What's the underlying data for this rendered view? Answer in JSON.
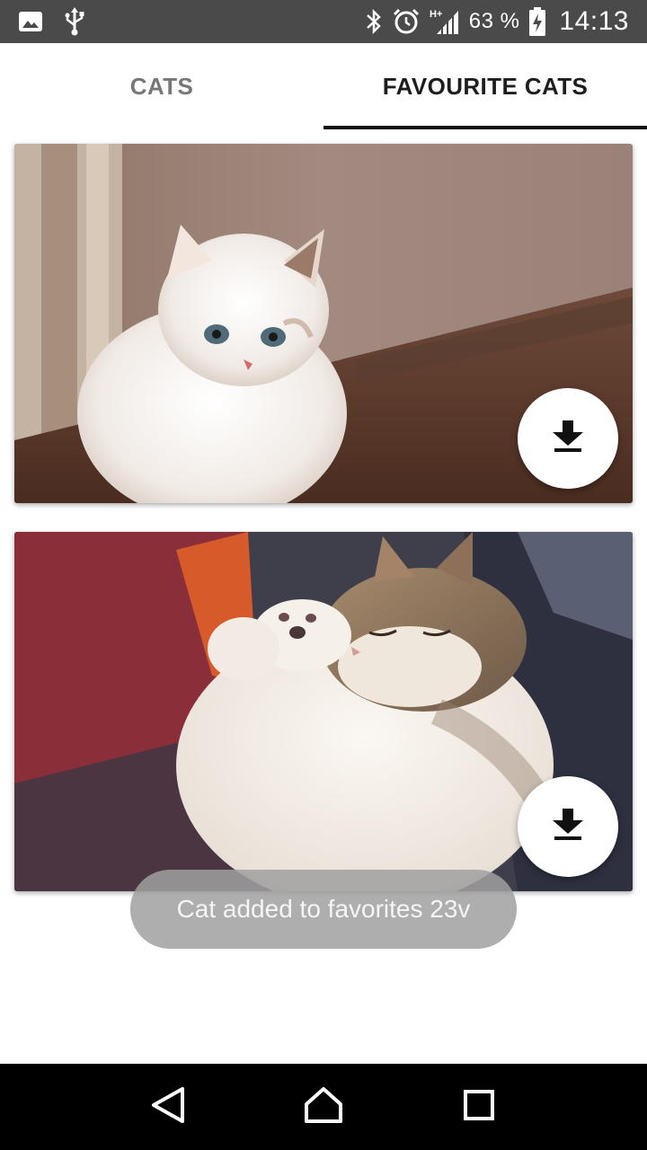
{
  "status_bar": {
    "battery_percent": "63 %",
    "time": "14:13",
    "network_label": "H+",
    "icons": [
      "image-icon",
      "usb-icon",
      "bluetooth-icon",
      "alarm-icon",
      "signal-icon",
      "battery-charging-icon"
    ]
  },
  "tabs": [
    {
      "label": "CATS",
      "active": false
    },
    {
      "label": "FAVOURITE CATS",
      "active": true
    }
  ],
  "cards": [
    {
      "image": "white fluffy kitten photo",
      "action_icon": "download-icon"
    },
    {
      "image": "sleeping tabby kitten photo",
      "action_icon": "download-icon"
    }
  ],
  "toast": {
    "message": "Cat added to favorites 23v"
  },
  "nav_bar": {
    "buttons": [
      "back-icon",
      "home-icon",
      "recents-icon"
    ]
  },
  "colors": {
    "status_bar_bg": "#4a4a4a",
    "tab_indicator": "#111111",
    "nav_bar_bg": "#000000"
  }
}
